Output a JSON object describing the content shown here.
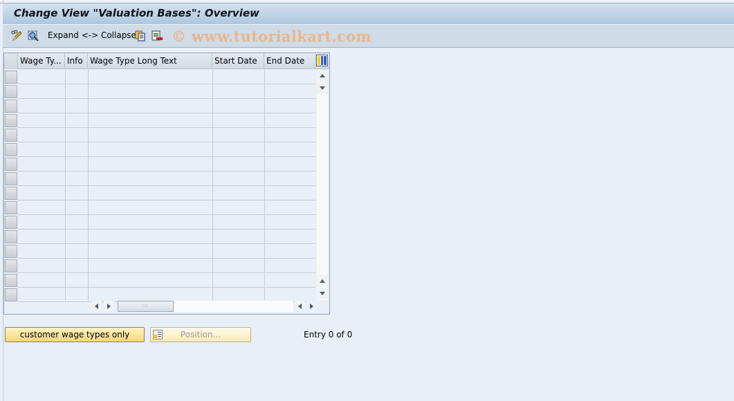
{
  "window": {
    "title": "Change View \"Valuation Bases\": Overview"
  },
  "toolbar": {
    "items": [
      {
        "icon": "display-change-icon",
        "tooltip": ""
      },
      {
        "icon": "find-icon",
        "tooltip": ""
      },
      {
        "label": "Expand <-> Collapse"
      },
      {
        "icon": "copy-as-icon"
      },
      {
        "icon": "delete-icon"
      }
    ],
    "expand_collapse_label": "Expand <-> Collapse",
    "watermark": "© www.tutorialkart.com"
  },
  "table": {
    "columns": [
      {
        "key": "wage_type",
        "label": "Wage Ty..."
      },
      {
        "key": "info",
        "label": "Info"
      },
      {
        "key": "long_text",
        "label": "Wage Type Long Text"
      },
      {
        "key": "start_date",
        "label": "Start Date"
      },
      {
        "key": "end_date",
        "label": "End Date"
      }
    ],
    "rows": [],
    "visible_empty_rows": 16,
    "column_config_icon": "table-settings-icon"
  },
  "buttons": {
    "customer_wage_types": "customer wage types only",
    "position": "Position..."
  },
  "status": {
    "entry_text": "Entry 0 of 0"
  },
  "colors": {
    "title_bar": "#afc6df",
    "toolbar": "#cfdbe6",
    "background": "#e8eff7",
    "button_yellow": "#f6d872"
  }
}
